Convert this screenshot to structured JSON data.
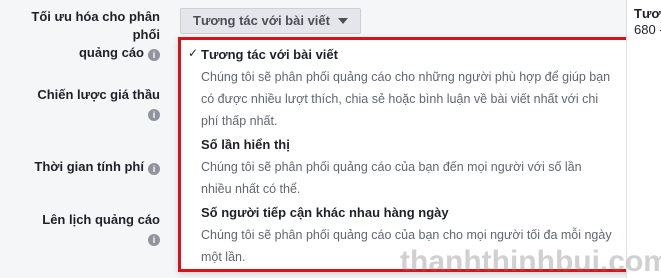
{
  "form": {
    "optimize_label_line1": "Tối ưu hóa cho phân phối",
    "optimize_label_line2": "quảng cáo",
    "bid_strategy_label": "Chiến lược giá thầu",
    "billing_label": "Thời gian tính phí",
    "schedule_label": "Lên lịch quảng cáo",
    "info_glyph": "i"
  },
  "dropdown": {
    "selected": "Tương tác với bài viết",
    "options": [
      {
        "title": "Tương tác với bài viết",
        "checked": true,
        "desc_lines": [
          "Chúng tôi sẽ phân phối quảng cáo cho những người phù hợp để giúp bạn",
          "có được nhiều lượt thích, chia sẻ hoặc bình luận về bài viết nhất với chi",
          "phí thấp nhất."
        ]
      },
      {
        "title": "Số lần hiển thị",
        "checked": false,
        "desc_lines": [
          "Chúng tôi sẽ phân phối quảng cáo của bạn đến mọi người với số lần",
          "nhiều nhất có thể."
        ]
      },
      {
        "title": "Số người tiếp cận khác nhau hàng ngày",
        "checked": false,
        "desc_lines": [
          "Chúng tôi sẽ phân phối quảng cáo của bạn cho mọi người tối đa mỗi ngày",
          "một lần."
        ]
      }
    ],
    "check_glyph": "✓"
  },
  "right_panel": {
    "title": "Tươn",
    "value": "680 -"
  },
  "watermark": "thanhthinhbui.com",
  "colors": {
    "highlight_border": "#d8121a",
    "trigger_bg": "#e4e6eb"
  }
}
